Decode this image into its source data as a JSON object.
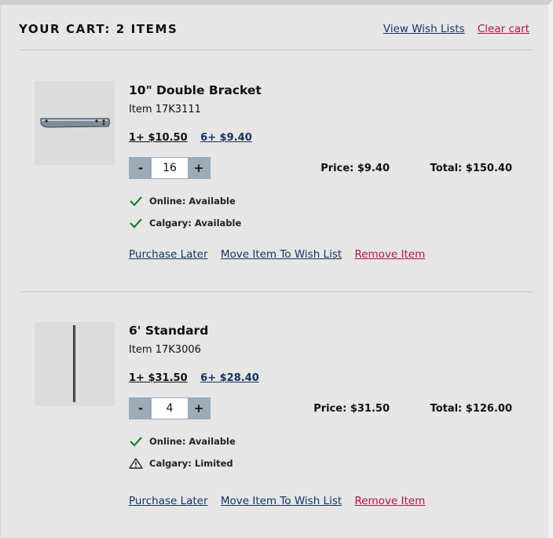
{
  "cart": {
    "title": "YOUR CART: 2 ITEMS",
    "view_wish_lists": "View Wish Lists",
    "clear_cart": "Clear cart"
  },
  "items": [
    {
      "name": "10\" Double Bracket",
      "sku": "Item 17K3111",
      "tier1": "1+ $10.50",
      "tier2": "6+ $9.40",
      "quantity": "16",
      "price": "Price: $9.40",
      "total": "Total: $150.40",
      "online": "Online: Available",
      "online_icon": "check-icon",
      "store": "Calgary: Available",
      "store_icon": "check-icon",
      "purchase_later": "Purchase Later",
      "move_to_wish_list": "Move Item To Wish List",
      "remove": "Remove Item",
      "decrement": "-",
      "increment": "+"
    },
    {
      "name": "6' Standard",
      "sku": "Item 17K3006",
      "tier1": "1+ $31.50",
      "tier2": "6+ $28.40",
      "quantity": "4",
      "price": "Price: $31.50",
      "total": "Total: $126.00",
      "online": "Online: Available",
      "online_icon": "check-icon",
      "store": "Calgary: Limited",
      "store_icon": "warning-icon",
      "purchase_later": "Purchase Later",
      "move_to_wish_list": "Move Item To Wish List",
      "remove": "Remove Item",
      "decrement": "-",
      "increment": "+"
    }
  ],
  "colors": {
    "background": "#e6e6e6",
    "link_blue": "#16325c",
    "link_red": "#b0144c",
    "check_green": "#1f7a2e",
    "stepper": "#9daab8"
  }
}
